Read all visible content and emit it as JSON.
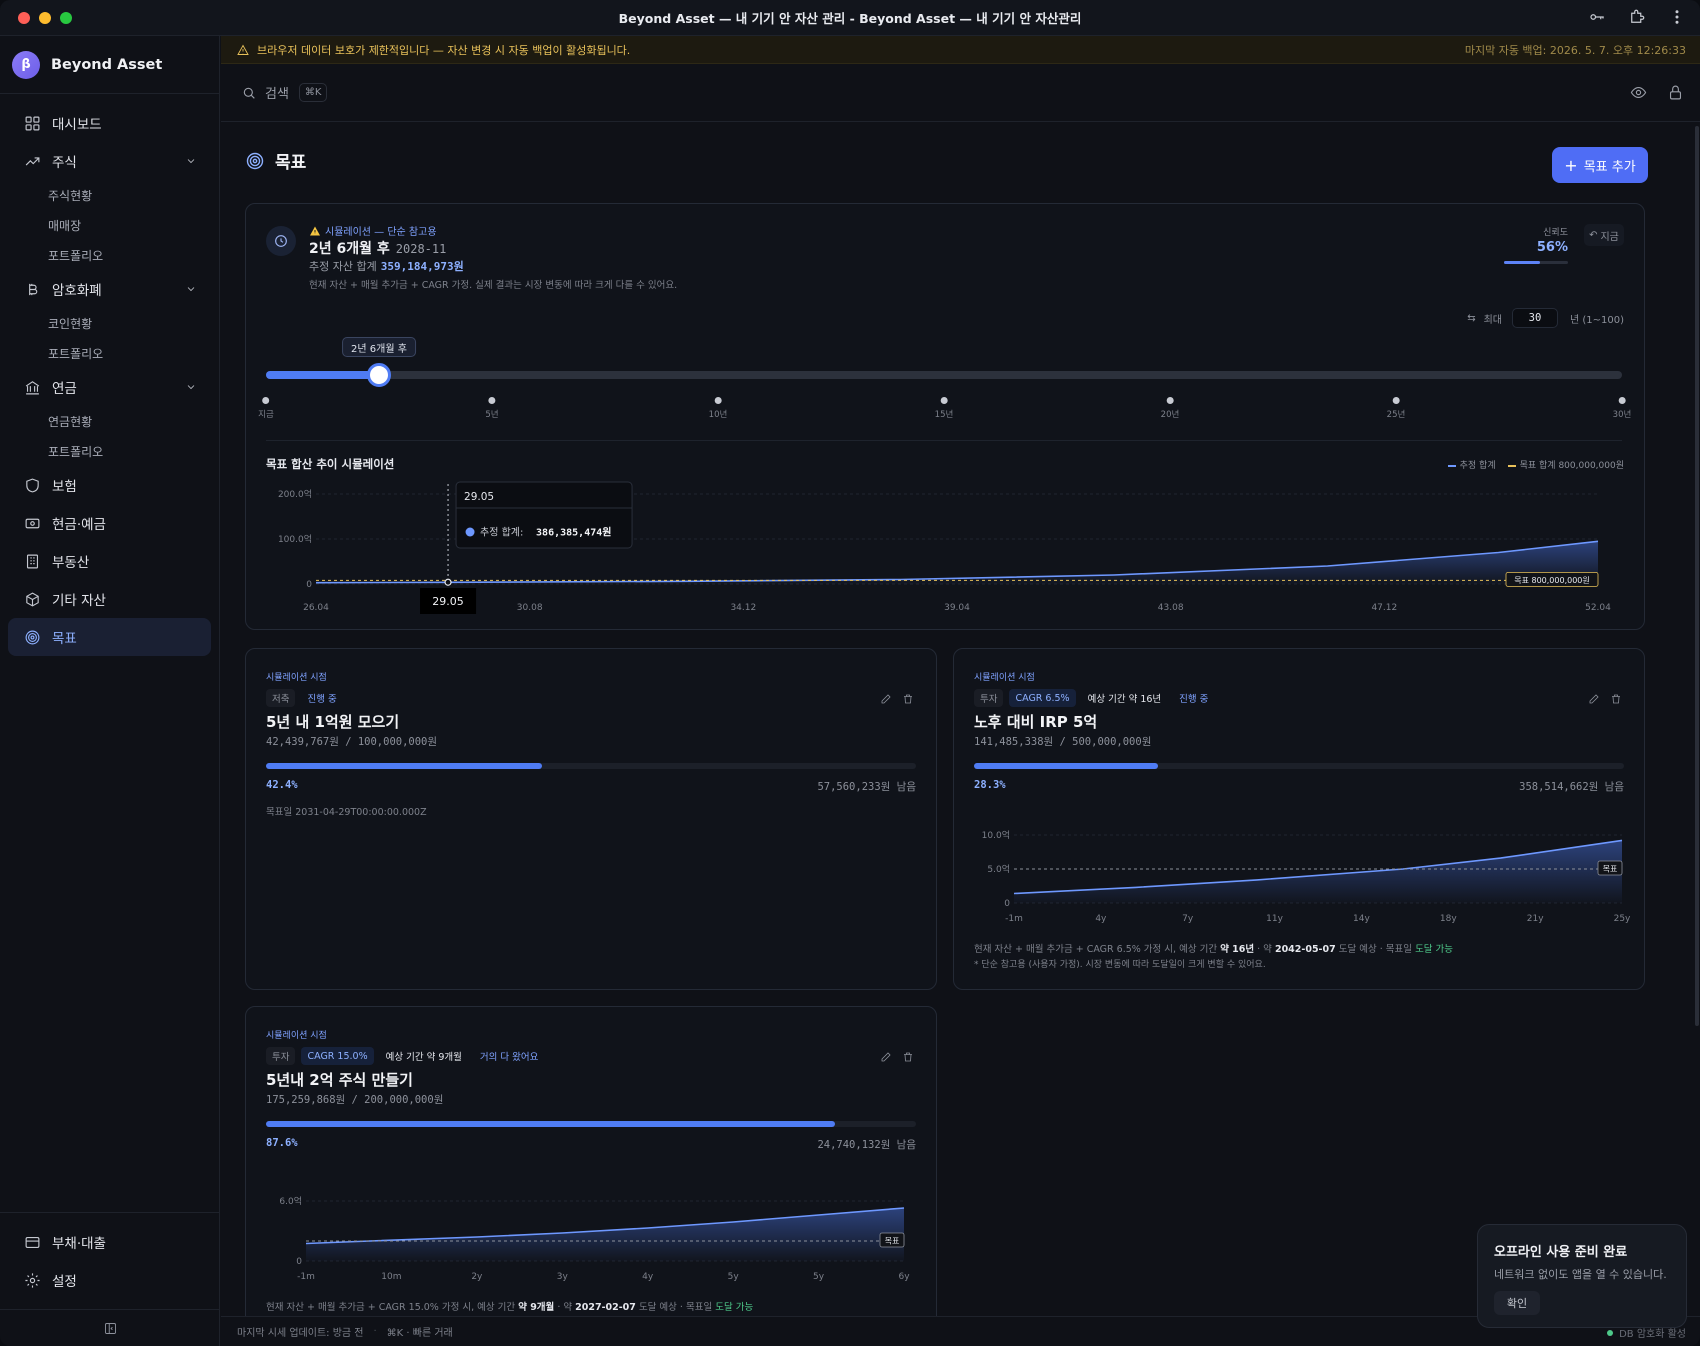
{
  "window": {
    "title": "Beyond Asset — 내 기기 안 자산 관리 - Beyond Asset — 내 기기 안 자산관리"
  },
  "brand": {
    "logo": "β",
    "name": "Beyond Asset"
  },
  "sidebar": {
    "items": [
      {
        "label": "대시보드",
        "icon": "dashboard-icon"
      },
      {
        "label": "주식",
        "icon": "trending-up-icon",
        "subs": [
          "주식현황",
          "매매장",
          "포트폴리오"
        ]
      },
      {
        "label": "암호화폐",
        "icon": "bitcoin-icon",
        "subs": [
          "코인현황",
          "포트폴리오"
        ]
      },
      {
        "label": "연금",
        "icon": "bank-icon",
        "subs": [
          "연금현황",
          "포트폴리오"
        ]
      },
      {
        "label": "보험",
        "icon": "shield-icon"
      },
      {
        "label": "현금·예금",
        "icon": "cash-icon"
      },
      {
        "label": "부동산",
        "icon": "building-icon"
      },
      {
        "label": "기타 자산",
        "icon": "package-icon"
      },
      {
        "label": "목표",
        "icon": "target-icon"
      }
    ],
    "bottom": [
      {
        "label": "부채·대출",
        "icon": "credit-card-icon"
      },
      {
        "label": "설정",
        "icon": "gear-icon"
      }
    ]
  },
  "banner": {
    "text": "브라우저 데이터 보호가 제한적입니다 — 자산 변경 시 자동 백업이 활성화됩니다.",
    "backup": "마지막 자동 백업: 2026. 5. 7. 오후 12:26:33"
  },
  "search": {
    "placeholder": "검색",
    "shortcut": "⌘K"
  },
  "page": {
    "title": "목표",
    "add_button": "목표 추가"
  },
  "simulation": {
    "warning": "시뮬레이션 — 단순 참고용",
    "when": "2년 6개월 후",
    "date": "2028-11",
    "total_label": "추정 자산 합계",
    "total_value": "359,184,973원",
    "desc": "현재 자산 + 매월 추가금 + CAGR 가정. 실제 결과는 시장 변동에 따라 크게 다를 수 있어요.",
    "confidence_label": "신뢰도",
    "confidence_value": "56%",
    "confidence": 0.56,
    "now_button": "지금",
    "max_label": "최대",
    "max_value": "30",
    "max_unit": "년 (1~100)",
    "slider_tooltip": "2년 6개월 후",
    "slider_value_years": 2.5,
    "slider_max_years": 30,
    "ticks": [
      "지금",
      "5년",
      "10년",
      "15년",
      "20년",
      "25년",
      "30년"
    ]
  },
  "chart_data": [
    {
      "type": "area",
      "title": "목표 합산 추이 시뮬레이션",
      "legend": [
        "추정 합계",
        "목표 합계 800,000,000원"
      ],
      "y_ticks": [
        "200.0억",
        "100.0억",
        "0"
      ],
      "x_ticks": [
        "26.04",
        "30.08",
        "34.12",
        "39.04",
        "43.08",
        "47.12",
        "52.04"
      ],
      "ylim": [
        0,
        20000000000
      ],
      "x_range": [
        2026.33,
        2056.33
      ],
      "x": [
        2026.33,
        2029.42,
        2035,
        2040,
        2045,
        2050,
        2054,
        2056.33
      ],
      "values": [
        300000000,
        386385474,
        600000000,
        1000000000,
        2000000000,
        4000000000,
        7000000000,
        9500000000
      ],
      "target_value": 800000000,
      "target_label": "목표 800,000,000원",
      "tooltip": {
        "title": "29.05",
        "label": "추정 합계:",
        "value": "386,385,474원",
        "x": 2029.42
      },
      "highlight_tick": "29.05"
    },
    {
      "type": "area",
      "y_ticks": [
        "10.0억",
        "5.0억",
        "0"
      ],
      "x_ticks": [
        "-1m",
        "4y",
        "7y",
        "11y",
        "14y",
        "18y",
        "21y",
        "25y"
      ],
      "ylim": [
        0,
        10
      ],
      "x_range": [
        0,
        25
      ],
      "x": [
        0,
        5,
        10,
        16,
        20,
        25
      ],
      "values": [
        1.4,
        2.3,
        3.4,
        5.0,
        6.6,
        9.2
      ],
      "target_value": 5.0,
      "target_label": "목표"
    },
    {
      "type": "area",
      "y_ticks": [
        "6.0억",
        "0"
      ],
      "x_ticks": [
        "-1m",
        "10m",
        "2y",
        "3y",
        "4y",
        "5y",
        "5y",
        "6y"
      ],
      "ylim": [
        0,
        6
      ],
      "x_range": [
        0,
        7
      ],
      "x": [
        0,
        0.75,
        2,
        3,
        4,
        5,
        6,
        7
      ],
      "values": [
        1.75,
        2.0,
        2.4,
        2.8,
        3.3,
        3.9,
        4.6,
        5.3
      ],
      "target_value": 2.0,
      "target_label": "목표"
    }
  ],
  "goals": [
    {
      "kicker": "시뮬레이션 시점",
      "tags": [
        {
          "t": "저축",
          "s": "gray"
        },
        {
          "t": "진행 중",
          "s": "bluet"
        }
      ],
      "title": "5년 내 1억원 모으기",
      "amount": "42,439,767원 / 100,000,000원",
      "progress": 0.424,
      "pct": "42.4%",
      "remaining": "57,560,233원",
      "remaining_suffix": "남음",
      "target_date": "목표일 2031-04-29T00:00:00.000Z"
    },
    {
      "kicker": "시뮬레이션 시점",
      "tags": [
        {
          "t": "투자",
          "s": "gray"
        },
        {
          "t": "CAGR 6.5%",
          "s": "blue"
        },
        {
          "t": "예상 기간 약 16년",
          "s": "plain"
        },
        {
          "t": "진행 중",
          "s": "bluet"
        }
      ],
      "title": "노후 대비 IRP 5억",
      "amount": "141,485,338원 / 500,000,000원",
      "progress": 0.283,
      "pct": "28.3%",
      "remaining": "358,514,662원",
      "remaining_suffix": "남음",
      "note1_a": "현재 자산 + 매월 추가금 + CAGR 6.5% 가정 시, 예상 기간",
      "note1_b": "약 16년",
      "note1_c": "· 약",
      "note1_d": "2042-05-07",
      "note1_e": "도달 예상 · 목표일",
      "note1_f": "도달 가능",
      "note2": "* 단순 참고용 (사용자 가정). 시장 변동에 따라 도달일이 크게 변할 수 있어요."
    },
    {
      "kicker": "시뮬레이션 시점",
      "tags": [
        {
          "t": "투자",
          "s": "gray"
        },
        {
          "t": "CAGR 15.0%",
          "s": "blue"
        },
        {
          "t": "예상 기간 약 9개월",
          "s": "plain"
        },
        {
          "t": "거의 다 왔어요",
          "s": "bluet"
        }
      ],
      "title": "5년내 2억 주식 만들기",
      "amount": "175,259,868원 / 200,000,000원",
      "progress": 0.876,
      "pct": "87.6%",
      "remaining": "24,740,132원",
      "remaining_suffix": "남음",
      "note1_a": "현재 자산 + 매월 추가금 + CAGR 15.0% 가정 시, 예상 기간",
      "note1_b": "약 9개월",
      "note1_c": "· 약",
      "note1_d": "2027-02-07",
      "note1_e": "도달 예상 · 목표일",
      "note1_f": "도달 가능"
    }
  ],
  "statusbar": {
    "updated": "마지막 시세 업데이트: 방금 전",
    "shortcut": "⌘K · 빠른 거래"
  },
  "toast": {
    "title": "오프라인 사용 준비 완료",
    "body": "네트워크 없이도 앱을 열 수 있습니다.",
    "button": "확인"
  },
  "db_status": "DB 암호화 활성"
}
